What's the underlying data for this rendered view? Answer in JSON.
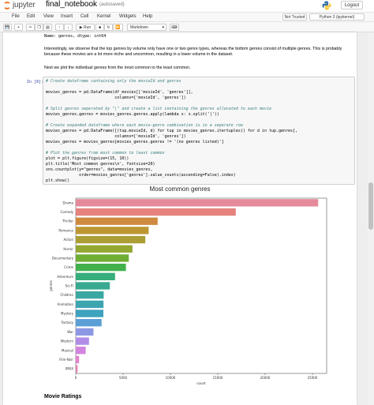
{
  "header": {
    "logo_text": "jupyter",
    "notebook_name": "final_notebook",
    "autosave": "(autosaved)",
    "logout_label": "Logout"
  },
  "menu": {
    "items": [
      "File",
      "Edit",
      "View",
      "Insert",
      "Cell",
      "Kernel",
      "Widgets",
      "Help"
    ],
    "trusted": "Not Trusted",
    "kernel": "Python 3 (ipykernel)"
  },
  "toolbar": {
    "run_label": "Run",
    "cell_type": "Markdown"
  },
  "output_prev": "Name: genres, dtype: int64",
  "markdown": {
    "p1": "Interestingly, we observe that the top genres by volume only have one or two genre types, whereas the bottom genres consist of multiple genres. This is probably because these movies are a lot more niche and uncommon, resulting in a lower volume in the dataset.",
    "p2": "Next we plot the individual genres from the most common to the least common."
  },
  "cell": {
    "prompt": "In [8]:",
    "lines": [
      "# Create dataframe containing only the movieId and genres",
      "",
      "movies_genres = pd.DataFrame(df_movies[['movieId', 'genres']],",
      "                             columns=['movieId', 'genres'])",
      "",
      "# Split genres seperated by \"|\" and create a list containing the genres allocated to each movie",
      "movies_genres.genres = movies_genres.genres.apply(lambda x: x.split('|'))",
      "",
      "# Create expanded dataframe where each movie-genre combination is in a seperate row",
      "movies_genres = pd.DataFrame([(tup.movieId, d) for tup in movies_genres.itertuples() for d in tup.genres],",
      "                             columns=['movieId', 'genres'])",
      "movies_genres = movies_genres[movies_genres.genres != '(no genres listed)']",
      "",
      "# Plot the genres from most common to least common",
      "plot = plt.figure(figsize=(15, 10))",
      "plt.title('Most common genres\\n', fontsize=20)",
      "sns.countplot(y=\"genres\", data=movies_genres,",
      "              order=movies_genres['genres'].value_counts(ascending=False).index)",
      "plt.show()"
    ]
  },
  "next_heading": "Movie Ratings",
  "chart_data": {
    "type": "bar",
    "orientation": "horizontal",
    "title": "Most common genres",
    "xlabel": "count",
    "ylabel": "genres",
    "xlim": [
      0,
      26500
    ],
    "xticks": [
      0,
      5000,
      10000,
      15000,
      20000,
      25000
    ],
    "categories": [
      "Drama",
      "Comedy",
      "Thriller",
      "Romance",
      "Action",
      "Horror",
      "Documentary",
      "Crime",
      "Adventure",
      "Sci-Fi",
      "Children",
      "Animation",
      "Mystery",
      "Fantasy",
      "War",
      "Western",
      "Musical",
      "Film-Noir",
      "IMAX"
    ],
    "values": [
      25600,
      16900,
      8650,
      7700,
      7350,
      5990,
      5600,
      5300,
      4150,
      3600,
      2950,
      2930,
      2920,
      2730,
      1870,
      1400,
      1050,
      350,
      200
    ],
    "colors": [
      "#e58a9a",
      "#e5827e",
      "#cf8a3f",
      "#bd9633",
      "#ab9e34",
      "#94a731",
      "#6eae33",
      "#42b14c",
      "#36ad7a",
      "#39aa91",
      "#3aa8a2",
      "#3ca5b0",
      "#3fa2be",
      "#5b9fd6",
      "#8d98e4",
      "#b18de7",
      "#d384e0",
      "#e181cc",
      "#e485b3"
    ]
  }
}
